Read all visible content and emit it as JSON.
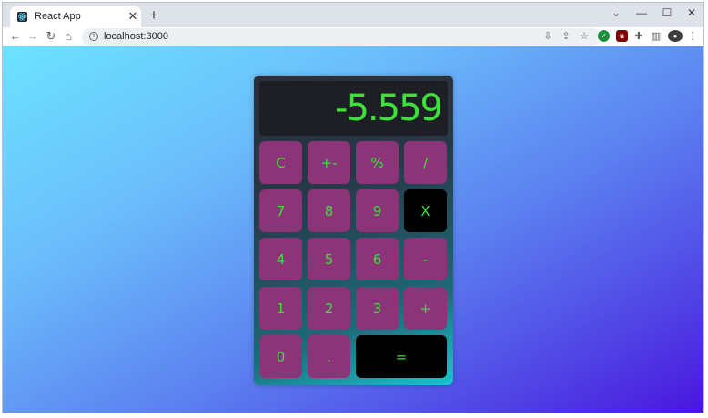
{
  "browser": {
    "tab": {
      "title": "React App",
      "favicon": "react-icon",
      "close_glyph": "✕"
    },
    "new_tab_glyph": "+",
    "window_controls": {
      "collapse": "⌄",
      "minimize": "—",
      "maximize": "☐",
      "close": "✕"
    },
    "toolbar": {
      "back": "←",
      "forward": "→",
      "reload": "↻",
      "home": "⌂",
      "url": "localhost:3000",
      "icons": [
        "install-app-icon",
        "share-icon",
        "bookmark-star-icon",
        "check-extension-icon",
        "ublock-extension-icon",
        "puzzle-extensions-icon",
        "side-panel-icon",
        "profile-avatar-icon",
        "kebab-menu-icon"
      ]
    }
  },
  "calculator": {
    "display": "-5.559",
    "keys": [
      {
        "label": "C",
        "style": "normal"
      },
      {
        "label": "+-",
        "style": "normal"
      },
      {
        "label": "%",
        "style": "normal"
      },
      {
        "label": "/",
        "style": "normal"
      },
      {
        "label": "7",
        "style": "normal"
      },
      {
        "label": "8",
        "style": "normal"
      },
      {
        "label": "9",
        "style": "normal"
      },
      {
        "label": "X",
        "style": "dark"
      },
      {
        "label": "4",
        "style": "normal"
      },
      {
        "label": "5",
        "style": "normal"
      },
      {
        "label": "6",
        "style": "normal"
      },
      {
        "label": "-",
        "style": "normal"
      },
      {
        "label": "1",
        "style": "normal"
      },
      {
        "label": "2",
        "style": "normal"
      },
      {
        "label": "3",
        "style": "normal"
      },
      {
        "label": "+",
        "style": "normal"
      },
      {
        "label": "0",
        "style": "normal"
      },
      {
        "label": ".",
        "style": "normal"
      },
      {
        "label": "=",
        "style": "dark"
      }
    ],
    "colors": {
      "key": "#8b3478",
      "key_dark": "#000000",
      "digits": "#3ee03a",
      "display_bg": "#1d1f24"
    }
  }
}
